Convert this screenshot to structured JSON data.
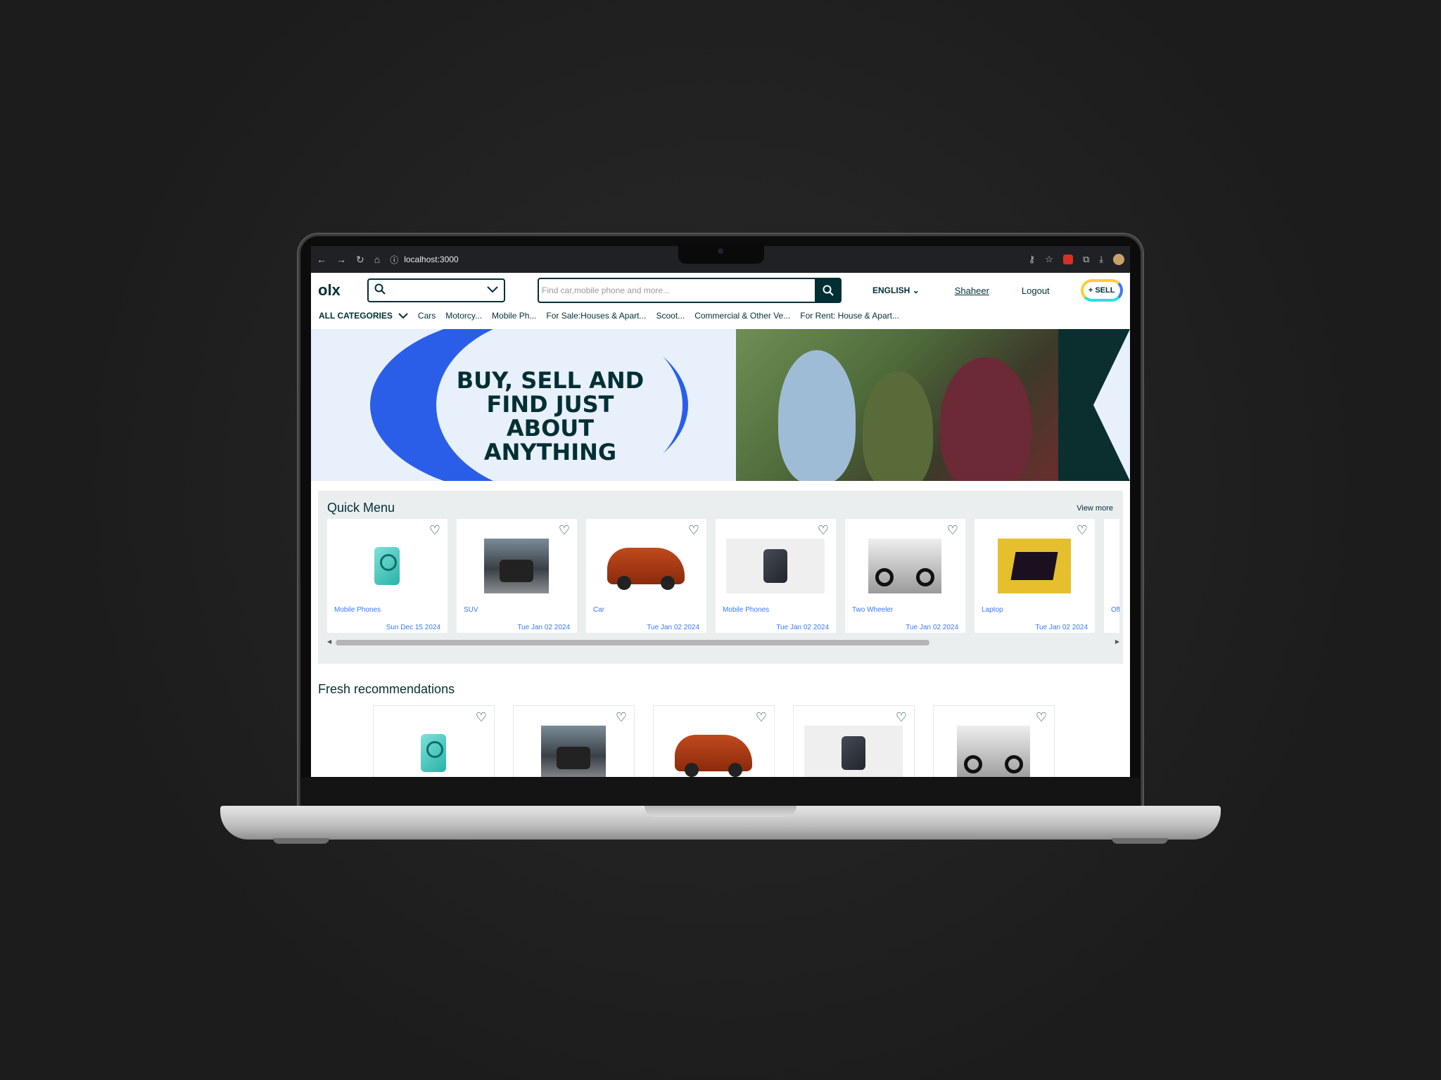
{
  "browser": {
    "url": "localhost:3000"
  },
  "header": {
    "logo": "olx",
    "search_placeholder": "Find car,mobile phone and more...",
    "language": "ENGLISH",
    "user": "Shaheer",
    "logout": "Logout",
    "sell": "SELL"
  },
  "categories": {
    "all_label": "ALL CATEGORIES",
    "items": [
      "Cars",
      "Motorcy...",
      "Mobile Ph...",
      "For Sale:Houses & Apart...",
      "Scoot...",
      "Commercial & Other Ve...",
      "For Rent: House & Apart..."
    ]
  },
  "banner": {
    "text": "BUY, SELL AND FIND JUST ABOUT ANYTHING"
  },
  "quick_menu": {
    "title": "Quick Menu",
    "view_more": "View more",
    "cards": [
      {
        "category": "Mobile Phones",
        "date": "Sun Dec 15 2024",
        "thumb": "teal-phone"
      },
      {
        "category": "SUV",
        "date": "Tue Jan 02 2024",
        "thumb": "jeep"
      },
      {
        "category": "Car",
        "date": "Tue Jan 02 2024",
        "thumb": "mini"
      },
      {
        "category": "Mobile Phones",
        "date": "Tue Jan 02 2024",
        "thumb": "iphone"
      },
      {
        "category": "Two Wheeler",
        "date": "Tue Jan 02 2024",
        "thumb": "bike"
      },
      {
        "category": "Laptop",
        "date": "Tue Jan 02 2024",
        "thumb": "laptop"
      },
      {
        "category": "Off",
        "date": "",
        "thumb": ""
      }
    ]
  },
  "fresh": {
    "title": "Fresh recommendations"
  },
  "icons": {
    "search": "search-icon",
    "heart": "heart-icon",
    "chevron": "chevron-down-icon"
  },
  "colors": {
    "brand": "#002f34",
    "accent_blue": "#3a77ff",
    "banner_ring": "#2b5ee8"
  }
}
